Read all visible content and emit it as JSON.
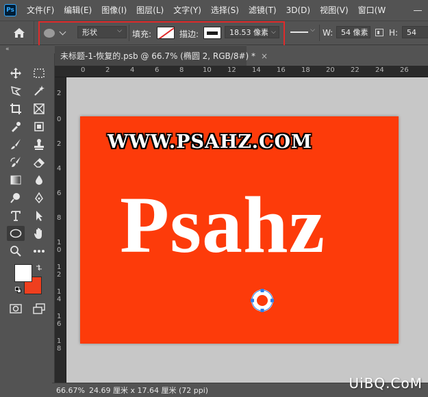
{
  "app": {
    "logo_text": "Ps"
  },
  "menu": {
    "items": [
      "文件(F)",
      "编辑(E)",
      "图像(I)",
      "图层(L)",
      "文字(Y)",
      "选择(S)",
      "滤镜(T)",
      "3D(D)",
      "视图(V)",
      "窗口(W"
    ]
  },
  "options": {
    "mode_value": "形状",
    "fill_label": "填充:",
    "stroke_label": "描边:",
    "stroke_width_value": "18.53 像素",
    "width_label": "W:",
    "width_value": "54 像素",
    "height_label": "H:",
    "height_value": "54",
    "fill_color": "#ffffff",
    "stroke_color": "#1b1b1b"
  },
  "toolbox": {
    "collapse_label": "«",
    "foreground_color": "#ffffff",
    "background_color": "#ef3f1e"
  },
  "document": {
    "tab_title": "未标题-1-恢复的.psb @ 66.7% (椭圆 2, RGB/8#) *",
    "tab_close": "×",
    "canvas_color": "#fd3b0a",
    "www_text": "WWW.PSAHZ.COM",
    "main_text": "Psahz",
    "handle_color": "#2b7de9"
  },
  "rulers": {
    "top": [
      "0",
      "2",
      "4",
      "6",
      "8",
      "10",
      "12",
      "14",
      "16",
      "18",
      "20",
      "22",
      "24",
      "26"
    ],
    "left": [
      "2",
      "0",
      "2",
      "4",
      "6",
      "8",
      "1\n0",
      "1\n2",
      "1\n4",
      "1\n6",
      "1\n8"
    ]
  },
  "status": {
    "zoom": "66.67%",
    "doc_info": "24.69 厘米 x 17.64 厘米 (72 ppi)"
  },
  "watermark": "UiBQ.CoM"
}
